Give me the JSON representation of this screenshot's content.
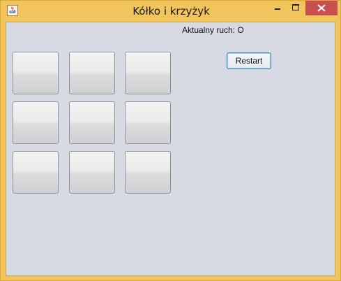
{
  "window": {
    "title": "Kółko i krzyżyk",
    "app_icon": "java-icon",
    "controls": [
      "minimize-icon",
      "maximize-icon",
      "close-icon"
    ]
  },
  "game": {
    "status_text": "Aktualny ruch: O",
    "restart_label": "Restart",
    "board": [
      [
        "",
        "",
        ""
      ],
      [
        "",
        "",
        ""
      ],
      [
        "",
        "",
        ""
      ]
    ]
  },
  "colors": {
    "frame": "#f2c55c",
    "content_bg": "#d7dae2",
    "close_button": "#c7504c",
    "button_focus_border": "#3c7fb1"
  }
}
